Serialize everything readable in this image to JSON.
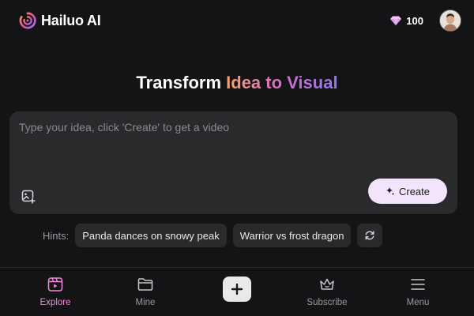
{
  "header": {
    "brand_name": "Hailuo AI",
    "credits": "100",
    "icons": {
      "logo": "hailuo-logo-icon",
      "credits": "gem-icon",
      "avatar": "user-avatar"
    }
  },
  "headline": {
    "plain": "Transform",
    "highlight": "Idea to Visual"
  },
  "prompt": {
    "value": "",
    "placeholder": "Type your idea, click 'Create' to get a video",
    "create_label": "Create",
    "icons": {
      "image_upload": "image-upload-icon",
      "create": "sparkle-icon"
    }
  },
  "hints": {
    "label": "Hints:",
    "items": [
      "Panda dances on snowy peak",
      "Warrior vs frost dragon"
    ],
    "refresh_icon": "refresh-icon"
  },
  "nav": {
    "items": [
      {
        "label": "Explore",
        "icon": "explore-icon",
        "active": true
      },
      {
        "label": "Mine",
        "icon": "folder-icon",
        "active": false
      },
      {
        "label": "",
        "icon": "plus-icon",
        "active": false
      },
      {
        "label": "Subscribe",
        "icon": "crown-icon",
        "active": false
      },
      {
        "label": "Menu",
        "icon": "menu-icon",
        "active": false
      }
    ]
  },
  "colors": {
    "background": "#141416",
    "surface": "#2a2a2d",
    "accent_pink": "#f08bd9",
    "create_button": "#f3e3fb",
    "gradient_start": "#f7a46b",
    "gradient_mid": "#d96ec6",
    "gradient_end": "#8f76f5"
  }
}
